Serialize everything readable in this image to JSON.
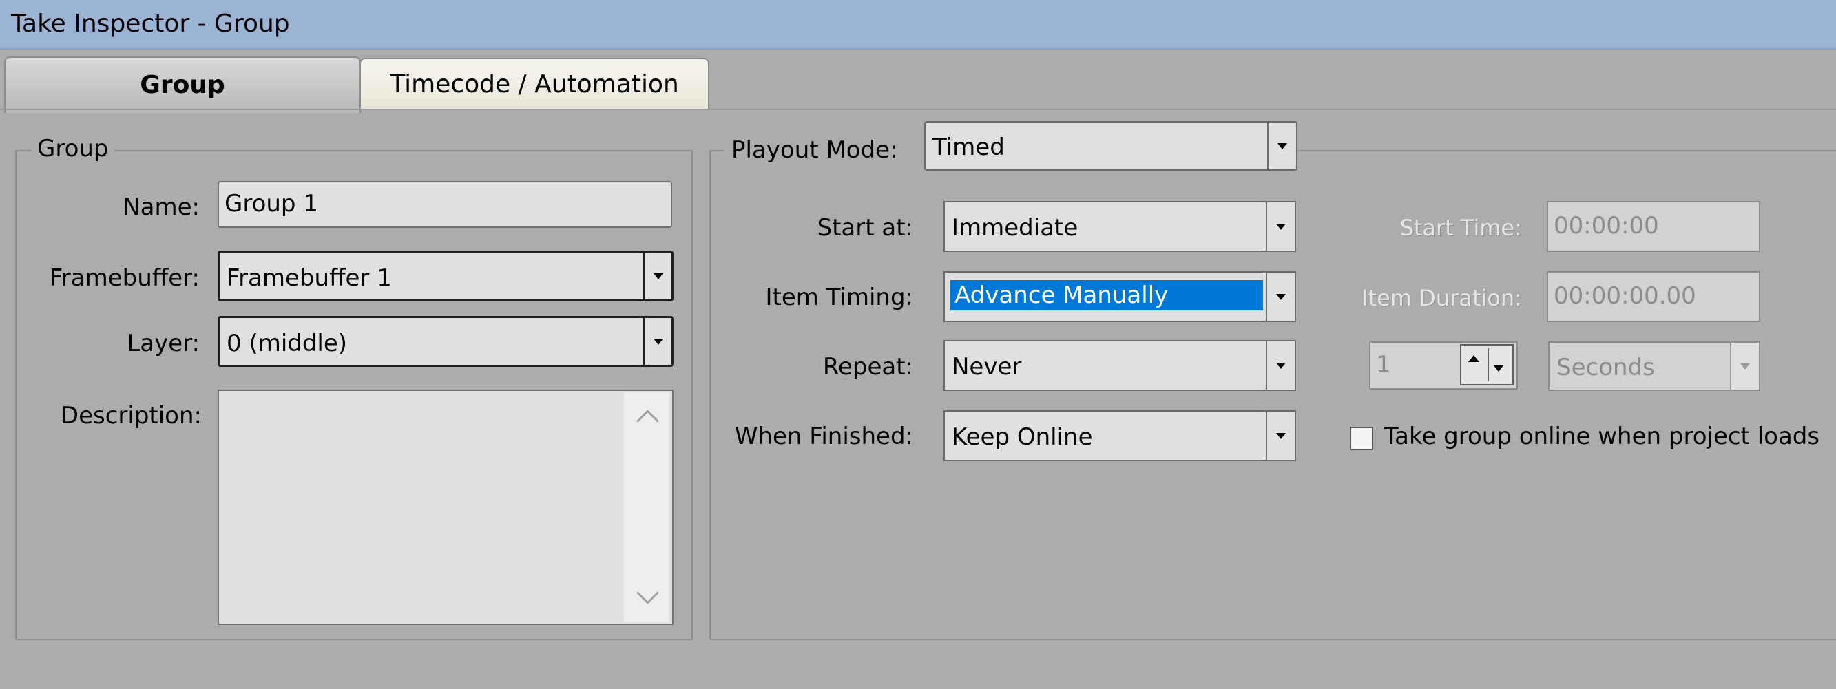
{
  "window": {
    "title": "Take Inspector - Group"
  },
  "tabs": [
    {
      "label": "Group",
      "active": true
    },
    {
      "label": "Timecode / Automation",
      "active": false
    }
  ],
  "group_section": {
    "legend": "Group",
    "name_label": "Name:",
    "name_value": "Group 1",
    "framebuffer_label": "Framebuffer:",
    "framebuffer_value": "Framebuffer 1",
    "layer_label": "Layer:",
    "layer_value": "0 (middle)",
    "description_label": "Description:",
    "description_value": ""
  },
  "playout": {
    "mode_label": "Playout Mode:",
    "mode_value": "Timed",
    "start_at_label": "Start at:",
    "start_at_value": "Immediate",
    "item_timing_label": "Item Timing:",
    "item_timing_value": "Advance Manually",
    "repeat_label": "Repeat:",
    "repeat_value": "Never",
    "when_finished_label": "When Finished:",
    "when_finished_value": "Keep Online",
    "start_time_label": "Start Time:",
    "start_time_value": "00:00:00",
    "item_duration_label": "Item Duration:",
    "item_duration_value": "00:00:00.00",
    "repeat_count_value": "1",
    "repeat_unit_value": "Seconds",
    "take_online_label": "Take group online when project loads",
    "take_online_checked": false
  },
  "colors": {
    "title_bar": "#9cb4d3",
    "background": "#acacac",
    "selection": "#0078d7"
  }
}
